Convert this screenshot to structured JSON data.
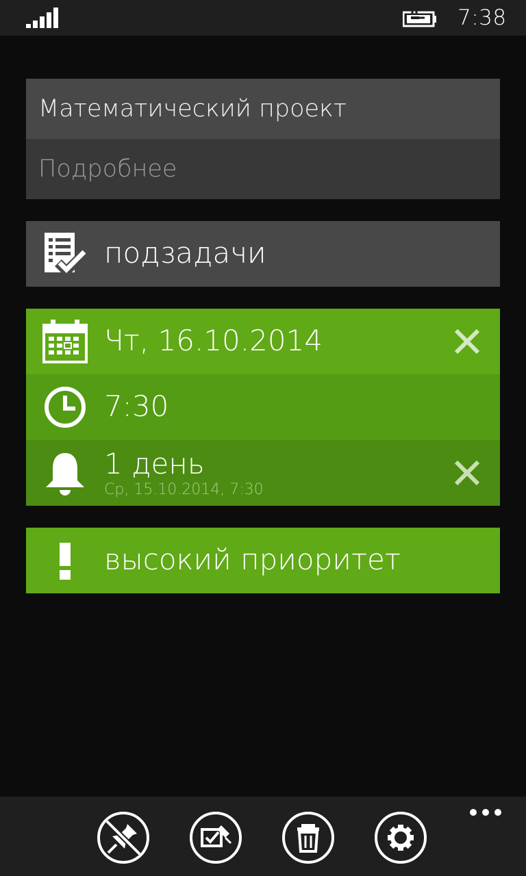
{
  "status_bar": {
    "time": "7:38",
    "signal_icon": "signal-strength-icon",
    "battery_icon": "battery-charging-icon"
  },
  "task": {
    "title": "Математический проект",
    "details_placeholder": "Подробнее"
  },
  "subtasks": {
    "label": "подзадачи",
    "icon": "checklist-icon"
  },
  "due": {
    "date": "Чт, 16.10.2014",
    "time": "7:30",
    "date_icon": "calendar-icon",
    "time_icon": "clock-icon"
  },
  "reminder": {
    "label": "1 день",
    "detail": "Ср, 15.10.2014, 7:30",
    "icon": "bell-icon"
  },
  "priority": {
    "label": "высокий приоритет",
    "icon": "exclamation-icon"
  },
  "app_bar": {
    "buttons": [
      "unpin-icon",
      "edit-task-icon",
      "delete-icon",
      "settings-icon"
    ],
    "more": "more-icon"
  },
  "colors": {
    "accent": "#60a917",
    "accent_dark": "#549c14",
    "accent_darker": "#4c8c12",
    "field": "#484848",
    "background": "#0c0c0c"
  }
}
